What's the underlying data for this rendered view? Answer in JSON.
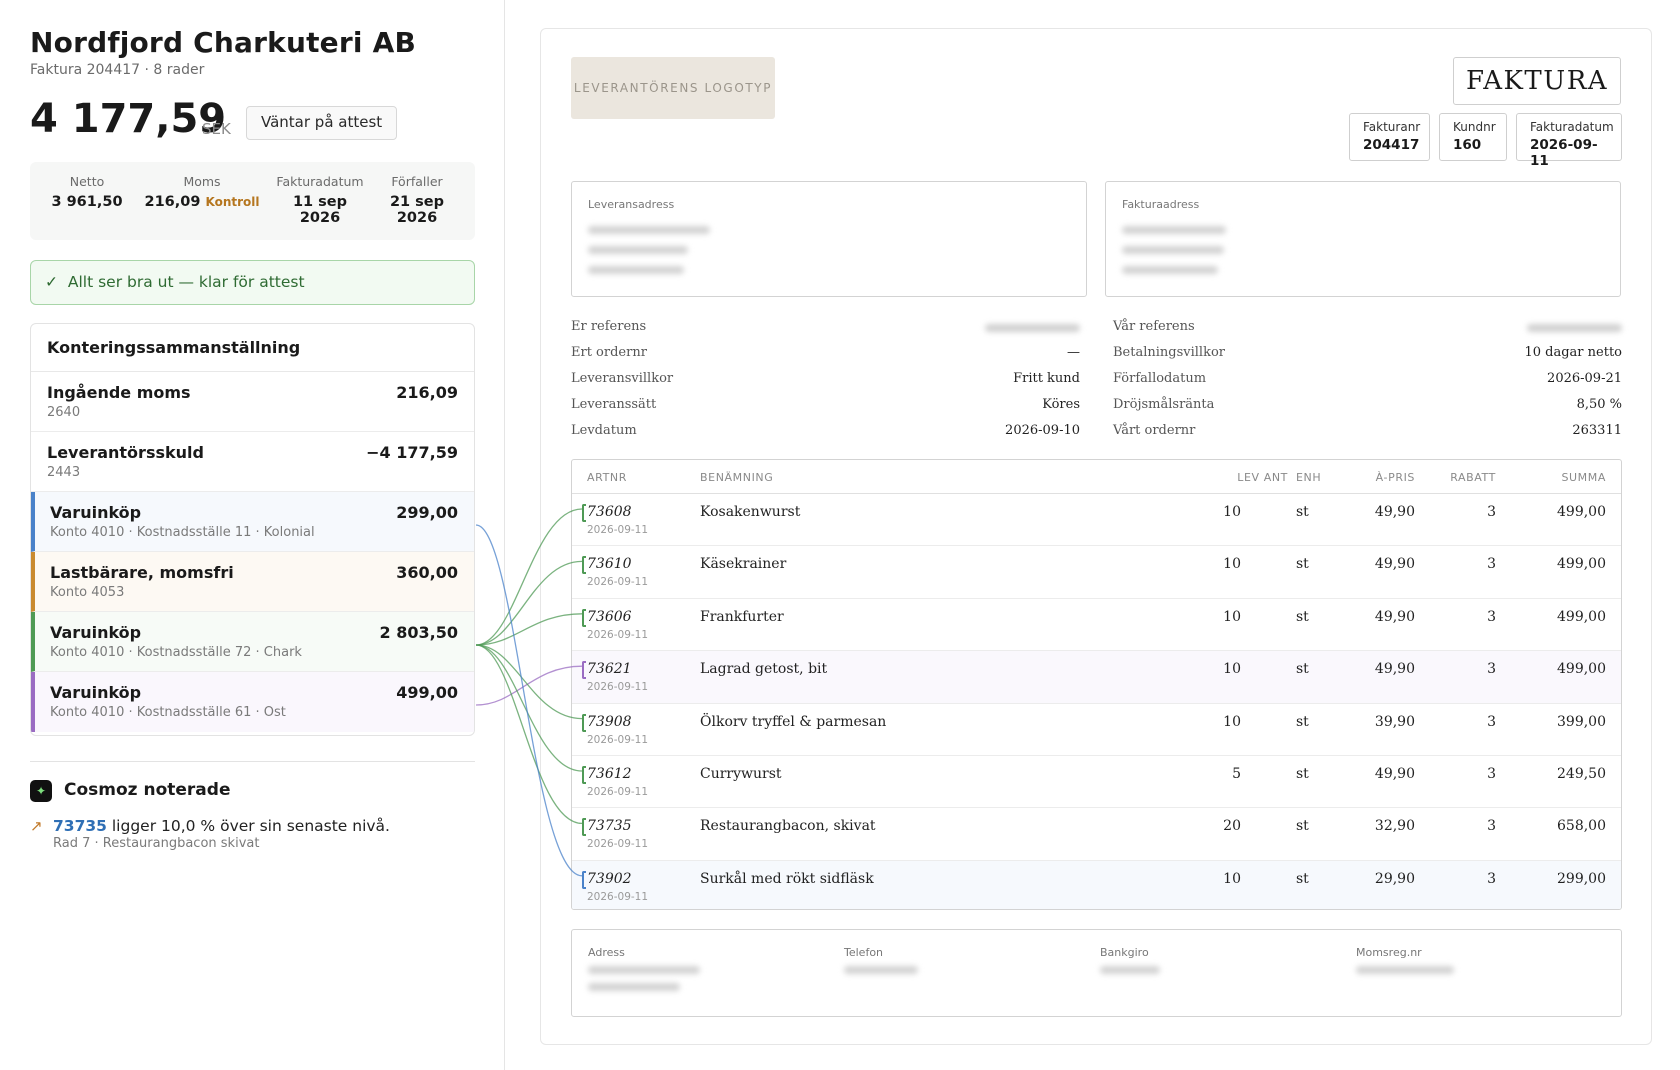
{
  "supplier": {
    "name": "Nordfjord Charkuteri AB",
    "subinfo": "Faktura 204417 · 8 rader"
  },
  "total": {
    "amount": "4 177,59",
    "currency": "SEK",
    "status": "Väntar på attest"
  },
  "summary": [
    {
      "label": "Netto",
      "value": "3 961,50"
    },
    {
      "label": "Moms",
      "value": "216,09",
      "flag": "Kontroll"
    },
    {
      "label": "Fakturadatum",
      "value_line1": "11 sep",
      "value_line2": "2026"
    },
    {
      "label": "Förfaller",
      "value_line1": "21 sep",
      "value_line2": "2026"
    }
  ],
  "banner": {
    "icon": "✓",
    "text": "Allt ser bra ut — klar för attest"
  },
  "posting": {
    "title": "Konteringssammanställning",
    "rows": [
      {
        "name": "Ingående moms",
        "sub": "2640",
        "amount": "216,09"
      },
      {
        "name": "Leverantörsskuld",
        "sub": "2443",
        "amount": "−4 177,59"
      },
      {
        "name": "Varuinköp",
        "sub": "Konto 4010 · Kostnadsställe 11 · Kolonial",
        "amount": "299,00",
        "color": "#4a82c9",
        "bg": "#f6f9fd"
      },
      {
        "name": "Lastbärare, momsfri",
        "sub": "Konto 4053",
        "amount": "360,00",
        "color": "#c98a2f",
        "bg": "#fdf9f3"
      },
      {
        "name": "Varuinköp",
        "sub": "Konto 4010 · Kostnadsställe 72 · Chark",
        "amount": "2 803,50",
        "color": "#4f9a55",
        "bg": "#f7fbf7"
      },
      {
        "name": "Varuinköp",
        "sub": "Konto 4010 · Kostnadsställe 61 · Ost",
        "amount": "499,00",
        "color": "#9a6cc2",
        "bg": "#faf7fd"
      }
    ]
  },
  "cosmoz": {
    "icon": "✦",
    "title": "Cosmoz noterade",
    "arrow": "↗",
    "link": "73735",
    "text": " ligger 10,0 % över sin senaste nivå.",
    "sub": "Rad 7 · Restaurangbacon skivat"
  },
  "invoice": {
    "logo": "LEVERANTÖRENS LOGOTYP",
    "title": "FAKTURA",
    "meta": [
      {
        "label": "Fakturanr",
        "value": "204417"
      },
      {
        "label": "Kundnr",
        "value": "160"
      },
      {
        "label": "Fakturadatum",
        "value": "2026-09-11"
      }
    ],
    "delivery_address_label": "Leveransadress",
    "billing_address_label": "Fakturaadress",
    "refs_left": [
      {
        "label": "Er referens",
        "value": ""
      },
      {
        "label": "Ert ordernr",
        "value": "—"
      },
      {
        "label": "Leveransvillkor",
        "value": "Fritt kund"
      },
      {
        "label": "Leveranssätt",
        "value": "Köres"
      },
      {
        "label": "Levdatum",
        "value": "2026-09-10"
      }
    ],
    "refs_right": [
      {
        "label": "Vår referens",
        "value": ""
      },
      {
        "label": "Betalningsvillkor",
        "value": "10 dagar netto"
      },
      {
        "label": "Förfallodatum",
        "value": "2026-09-21"
      },
      {
        "label": "Dröjsmålsränta",
        "value": "8,50 %"
      },
      {
        "label": "Vårt ordernr",
        "value": "263311"
      }
    ],
    "columns": {
      "art": "ARTNR",
      "ben": "BENÄMNING",
      "qty": "LEV ANT",
      "enh": "ENH",
      "pris": "À-PRIS",
      "rab": "RABATT",
      "sum": "SUMMA"
    },
    "items": [
      {
        "art": "73608",
        "date": "2026-09-11",
        "ben": "Kosakenwurst",
        "qty": "10",
        "enh": "st",
        "pris": "49,90",
        "rab": "3",
        "sum": "499,00",
        "color": "#4f9a55",
        "bg": "#ffffff"
      },
      {
        "art": "73610",
        "date": "2026-09-11",
        "ben": "Käsekrainer",
        "qty": "10",
        "enh": "st",
        "pris": "49,90",
        "rab": "3",
        "sum": "499,00",
        "color": "#4f9a55",
        "bg": "#ffffff"
      },
      {
        "art": "73606",
        "date": "2026-09-11",
        "ben": "Frankfurter",
        "qty": "10",
        "enh": "st",
        "pris": "49,90",
        "rab": "3",
        "sum": "499,00",
        "color": "#4f9a55",
        "bg": "#ffffff"
      },
      {
        "art": "73621",
        "date": "2026-09-11",
        "ben": "Lagrad getost, bit",
        "qty": "10",
        "enh": "st",
        "pris": "49,90",
        "rab": "3",
        "sum": "499,00",
        "color": "#9a6cc2",
        "bg": "#faf8fd"
      },
      {
        "art": "73908",
        "date": "2026-09-11",
        "ben": "Ölkorv tryffel & parmesan",
        "qty": "10",
        "enh": "st",
        "pris": "39,90",
        "rab": "3",
        "sum": "399,00",
        "color": "#4f9a55",
        "bg": "#ffffff"
      },
      {
        "art": "73612",
        "date": "2026-09-11",
        "ben": "Currywurst",
        "qty": "5",
        "enh": "st",
        "pris": "49,90",
        "rab": "3",
        "sum": "249,50",
        "color": "#4f9a55",
        "bg": "#ffffff"
      },
      {
        "art": "73735",
        "date": "2026-09-11",
        "ben": "Restaurangbacon, skivat",
        "qty": "20",
        "enh": "st",
        "pris": "32,90",
        "rab": "3",
        "sum": "658,00",
        "color": "#4f9a55",
        "bg": "#ffffff"
      },
      {
        "art": "73902",
        "date": "2026-09-11",
        "ben": "Surkål med rökt sidfläsk",
        "qty": "10",
        "enh": "st",
        "pris": "29,90",
        "rab": "3",
        "sum": "299,00",
        "color": "#4a82c9",
        "bg": "#f6f9fd"
      }
    ],
    "footer": [
      {
        "label": "Adress"
      },
      {
        "label": "Telefon"
      },
      {
        "label": "Bankgiro"
      },
      {
        "label": "Momsreg.nr"
      }
    ]
  }
}
